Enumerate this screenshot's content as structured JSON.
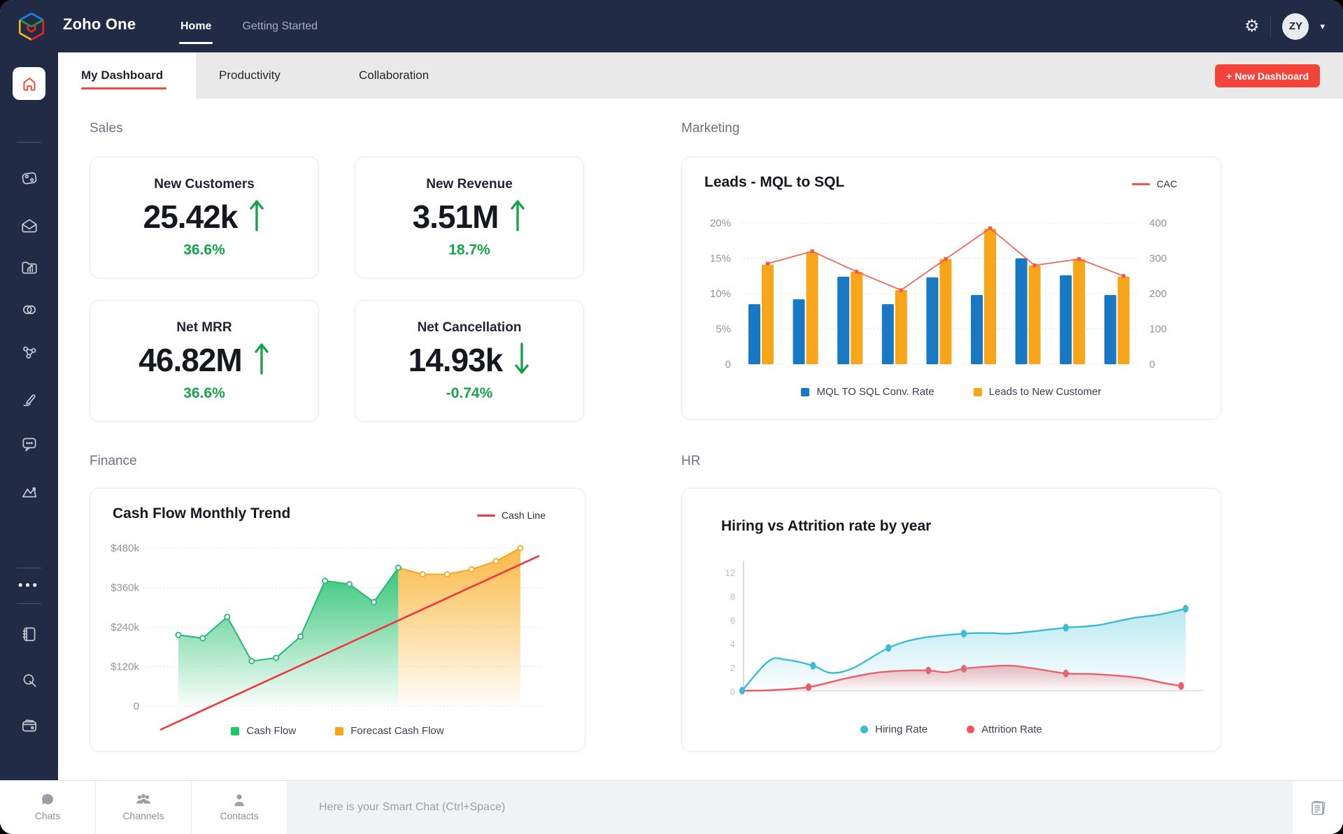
{
  "app": {
    "title": "Zoho One",
    "nav": [
      {
        "label": "Home"
      },
      {
        "label": "Getting Started"
      }
    ],
    "user_initials": "ZY"
  },
  "sidebar": {
    "icons": [
      "home",
      "crm",
      "mail",
      "workdrive",
      "connect",
      "social",
      "sign",
      "cliq",
      "analytics",
      "more",
      "notebook",
      "search",
      "wallet"
    ]
  },
  "tabs": {
    "items": [
      {
        "label": "My Dashboard"
      },
      {
        "label": "Productivity"
      },
      {
        "label": "Collaboration"
      }
    ],
    "new_dashboard": "+ New Dashboard"
  },
  "sections": {
    "sales": {
      "label": "Sales",
      "cards": [
        {
          "title": "New Customers",
          "value": "25.42k",
          "change": "36.6%",
          "direction": "up"
        },
        {
          "title": "New Revenue",
          "value": "3.51M",
          "change": "18.7%",
          "direction": "up"
        },
        {
          "title": "Net MRR",
          "value": "46.82M",
          "change": "36.6%",
          "direction": "up"
        },
        {
          "title": "Net Cancellation",
          "value": "14.93k",
          "change": "-0.74%",
          "direction": "down"
        }
      ]
    },
    "marketing": {
      "label": "Marketing"
    },
    "finance": {
      "label": "Finance"
    },
    "hr": {
      "label": "HR"
    }
  },
  "chart_data": [
    {
      "id": "marketing",
      "type": "bar",
      "title": "Leads - MQL to SQL",
      "left_axis": {
        "labels": [
          "20%",
          "15%",
          "10%",
          "5%",
          "0"
        ],
        "max": 20
      },
      "right_axis": {
        "labels": [
          "400",
          "300",
          "200",
          "100",
          "0"
        ],
        "max": 400
      },
      "series": [
        {
          "name": "MQL TO SQL Conv. Rate",
          "color": "#1779C4",
          "values": [
            8.5,
            9.2,
            12.4,
            8.5,
            12.3,
            9.8,
            15.0,
            12.6,
            9.8
          ]
        },
        {
          "name": "Leads to New Customer",
          "color": "#F9A51A",
          "values": [
            14.1,
            15.8,
            13.1,
            10.5,
            14.9,
            19.2,
            14.0,
            14.9,
            12.4
          ]
        }
      ],
      "line": {
        "name": "CAC",
        "color": "#F5544C",
        "values": [
          285,
          320,
          262,
          210,
          298,
          385,
          280,
          298,
          250
        ]
      }
    },
    {
      "id": "finance",
      "type": "area",
      "title": "Cash Flow Monthly Trend",
      "y_axis": {
        "labels": [
          "$480k",
          "$360k",
          "$240k",
          "$120k",
          "0"
        ],
        "max": 480
      },
      "legend": [
        "Cash Flow",
        "Forecast Cash Flow"
      ],
      "actual_color": "#23B976",
      "forecast_color": "#F6A723",
      "actual_values": [
        215,
        205,
        270,
        135,
        145,
        210,
        380,
        370,
        315,
        420
      ],
      "forecast_values": [
        420,
        400,
        400,
        415,
        440,
        480
      ],
      "trend_line": {
        "name": "Cash Line",
        "color": "#F2353F",
        "start": 95,
        "end": 490
      }
    },
    {
      "id": "hr",
      "type": "line",
      "title": "Hiring vs Attrition rate by year",
      "y_axis": {
        "labels": [
          "12",
          "8",
          "6",
          "4",
          "2",
          "0"
        ]
      },
      "series": [
        {
          "name": "Hiring Rate",
          "color": "#3BBBD4",
          "markers": [
            [
              0,
              0
            ],
            [
              16,
              2.1
            ],
            [
              33,
              3.6
            ],
            [
              50,
              4.8
            ],
            [
              73,
              5.3
            ],
            [
              100,
              6.9
            ]
          ],
          "curve": [
            [
              0,
              0
            ],
            [
              6,
              2.5
            ],
            [
              10,
              2.6
            ],
            [
              16,
              2.1
            ],
            [
              20,
              1.5
            ],
            [
              25,
              1.9
            ],
            [
              33,
              3.6
            ],
            [
              40,
              4.4
            ],
            [
              50,
              4.8
            ],
            [
              56,
              4.85
            ],
            [
              60,
              4.8
            ],
            [
              67,
              5.05
            ],
            [
              73,
              5.3
            ],
            [
              80,
              5.5
            ],
            [
              88,
              6.1
            ],
            [
              94,
              6.4
            ],
            [
              100,
              6.9
            ]
          ]
        },
        {
          "name": "Attrition Rate",
          "color": "#F4535E",
          "markers": [
            [
              15,
              0.3
            ],
            [
              42,
              1.7
            ],
            [
              50,
              1.85
            ],
            [
              73,
              1.45
            ],
            [
              99,
              0.4
            ]
          ],
          "curve": [
            [
              0,
              0
            ],
            [
              7,
              0.05
            ],
            [
              15,
              0.3
            ],
            [
              23,
              1.0
            ],
            [
              30,
              1.5
            ],
            [
              36,
              1.68
            ],
            [
              42,
              1.7
            ],
            [
              46,
              1.55
            ],
            [
              50,
              1.85
            ],
            [
              56,
              2.05
            ],
            [
              61,
              2.1
            ],
            [
              67,
              1.8
            ],
            [
              73,
              1.45
            ],
            [
              79,
              1.4
            ],
            [
              85,
              1.25
            ],
            [
              90,
              1.05
            ],
            [
              95,
              0.65
            ],
            [
              99,
              0.4
            ]
          ]
        }
      ]
    }
  ],
  "smartbar": {
    "tabs": [
      {
        "label": "Chats"
      },
      {
        "label": "Channels"
      },
      {
        "label": "Contacts"
      }
    ],
    "placeholder": "Here is your Smart Chat (Ctrl+Space)"
  },
  "colors": {
    "navy": "#222B45",
    "accent_red": "#F0483E",
    "kpi_green": "#17A24B",
    "bar_blue": "#1779C4",
    "bar_orange": "#F9A51A",
    "cac_red": "#F5544C",
    "hiring_cyan": "#3BBBD4",
    "attrition_red": "#F4535E"
  }
}
